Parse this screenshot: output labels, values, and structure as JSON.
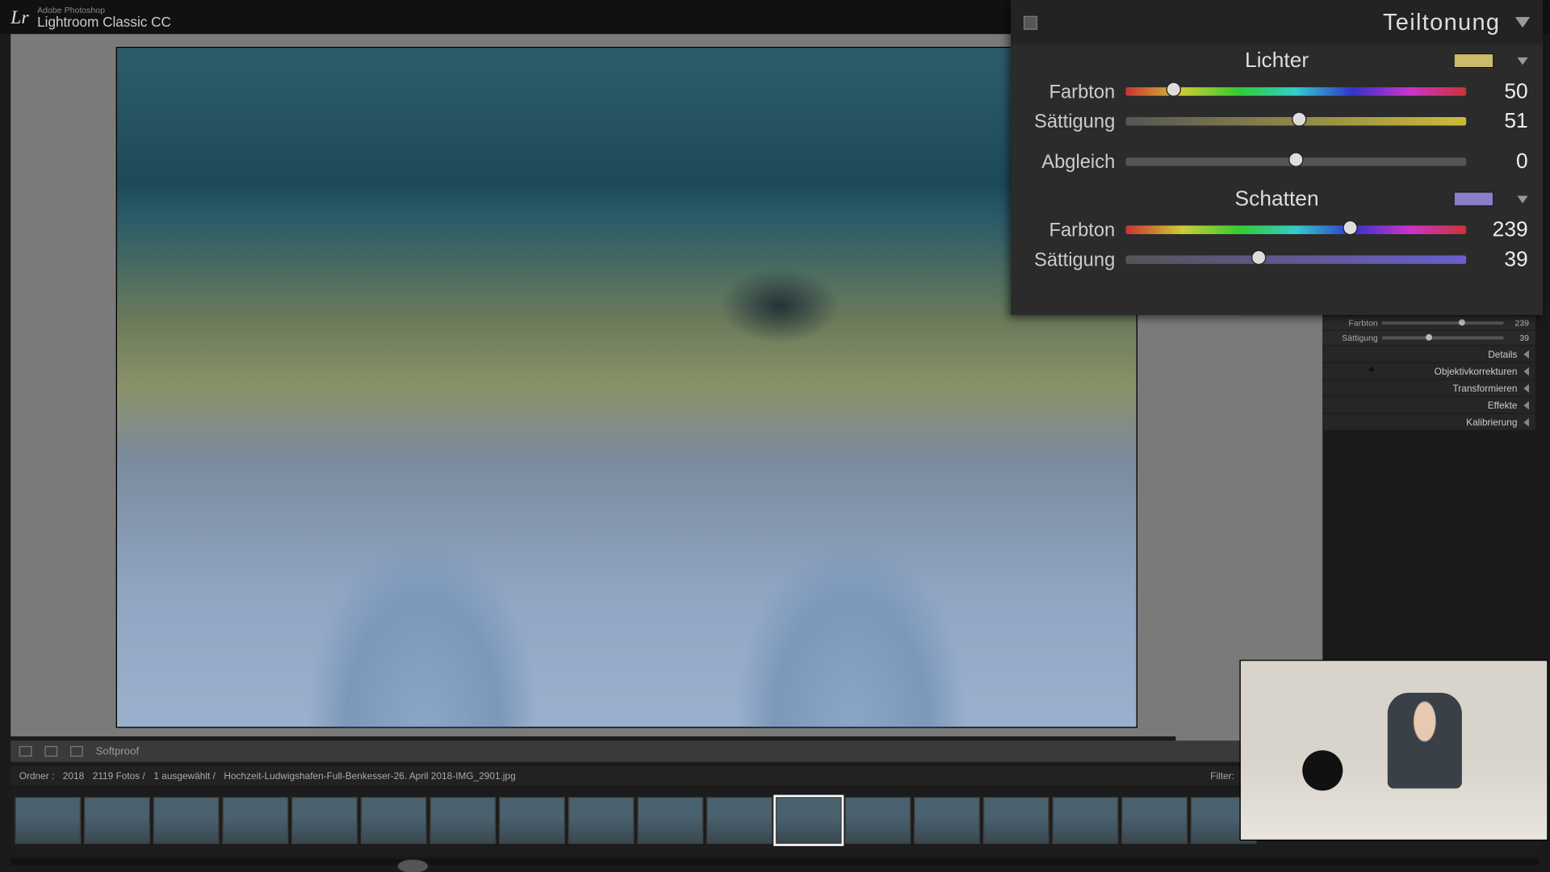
{
  "app": {
    "sub": "Adobe Photoshop",
    "name": "Lightroom Classic CC",
    "logo": "Lr"
  },
  "toolstrip": {
    "softproof": "Softproof"
  },
  "infostrip": {
    "folder_label": "Ordner :",
    "folder": "2018",
    "count": "2119 Fotos /",
    "selected": "1 ausgewählt /",
    "filename": "Hochzeit-Ludwigshafen-Full-Benkesser-26. April 2018-IMG_2901.jpg",
    "filter": "Filter:"
  },
  "overlay": {
    "title": "Teiltonung",
    "highlights": {
      "label": "Lichter",
      "hue_label": "Farbton",
      "hue_value": "50",
      "sat_label": "Sättigung",
      "sat_value": "51"
    },
    "balance": {
      "label": "Abgleich",
      "value": "0"
    },
    "shadows": {
      "label": "Schatten",
      "hue_label": "Farbton",
      "hue_value": "239",
      "sat_label": "Sättigung",
      "sat_value": "39"
    }
  },
  "sidepanel": {
    "rows": [
      {
        "l": "Farbton",
        "v": "239",
        "pct": 66
      },
      {
        "l": "Sättigung",
        "v": "39",
        "pct": 39
      }
    ],
    "sections": [
      "Details",
      "Objektivkorrekturen",
      "Transformieren",
      "Effekte",
      "Kalibrierung"
    ]
  },
  "thumbs": {
    "count": 18,
    "selected": 11
  }
}
